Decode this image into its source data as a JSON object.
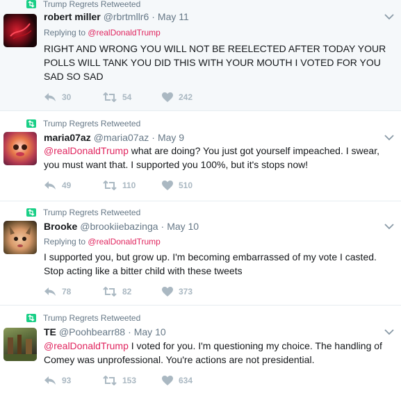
{
  "tweets": [
    {
      "retweet_label": "Trump Regrets Retweeted",
      "name": "robert miller",
      "handle": "@rbrtmllr6",
      "date": "May 11",
      "reply_prefix": "Replying to",
      "reply_handle": "@realDonaldTrump",
      "mention": "",
      "text": "RIGHT AND WRONG YOU WILL NOT BE REELECTED AFTER TODAY YOUR POLLS WILL TANK YOU DID THIS WITH YOUR MOUTH I VOTED FOR YOU SAD  SO SAD",
      "replies": "30",
      "retweets": "54",
      "likes": "242"
    },
    {
      "retweet_label": "Trump Regrets Retweeted",
      "name": "maria07az",
      "handle": "@maria07az",
      "date": "May 9",
      "reply_prefix": "",
      "reply_handle": "",
      "mention": "@realDonaldTrump",
      "text": " what are doing? You just got yourself impeached. I swear, you must want that. I supported you 100%, but it's stops now!",
      "replies": "49",
      "retweets": "110",
      "likes": "510"
    },
    {
      "retweet_label": "Trump Regrets Retweeted",
      "name": "Brooke",
      "handle": "@brookiiebazinga",
      "date": "May 10",
      "reply_prefix": "Replying to",
      "reply_handle": "@realDonaldTrump",
      "mention": "",
      "text": "I supported you, but grow up. I'm becoming embarrassed of my vote I casted. Stop acting like a bitter child with these tweets",
      "replies": "78",
      "retweets": "82",
      "likes": "373"
    },
    {
      "retweet_label": "Trump Regrets Retweeted",
      "name": "TE",
      "handle": "@Poohbearr88",
      "date": "May 10",
      "reply_prefix": "",
      "reply_handle": "",
      "mention": "@realDonaldTrump",
      "text": " I voted for you. I'm questioning my choice. The handling of Comey was unprofessional. You're actions are not presidential.",
      "replies": "93",
      "retweets": "153",
      "likes": "634"
    }
  ],
  "sep": "·",
  "colors": {
    "accent_link": "#e0245e",
    "retweet_green": "#19cf86",
    "muted": "#657786",
    "action_gray": "#aab8c2"
  },
  "icons": {
    "retweet_badge": "retweet-icon",
    "reply": "reply-icon",
    "retweet": "retweet-icon",
    "like": "heart-icon",
    "menu": "chevron-down-icon"
  }
}
